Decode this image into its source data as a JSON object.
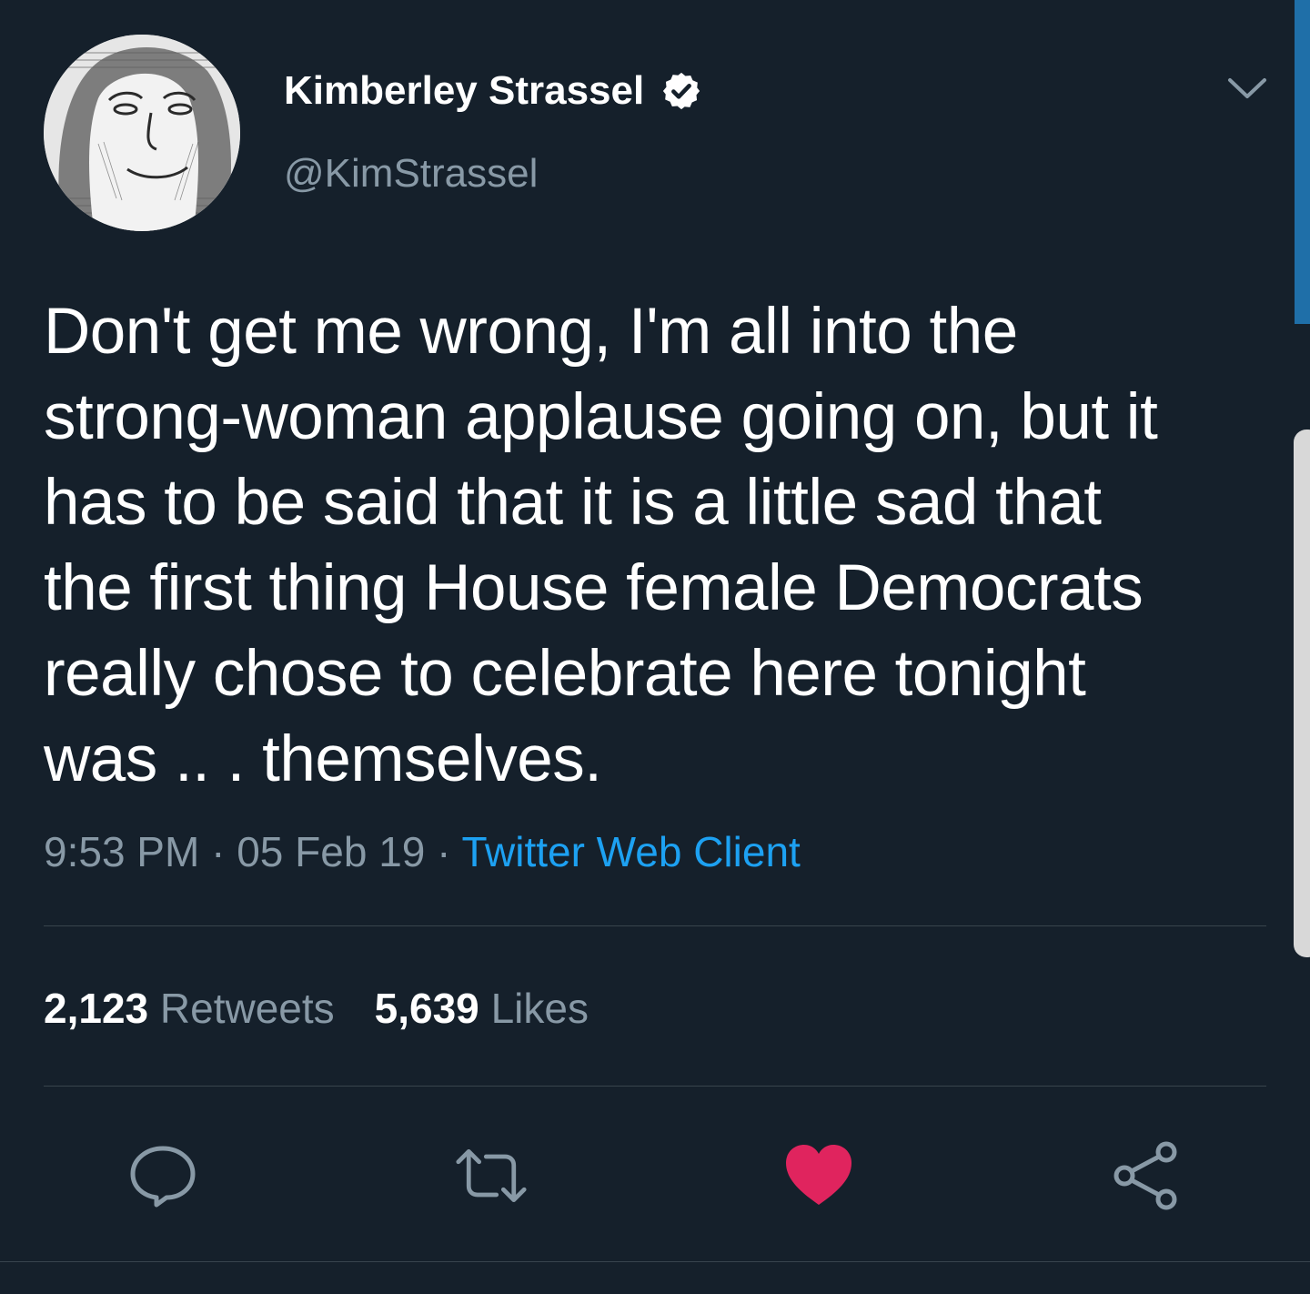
{
  "user": {
    "display_name": "Kimberley Strassel",
    "handle": "@KimStrassel",
    "verified": true
  },
  "tweet": {
    "text": "Don't get me wrong, I'm all into the\nstrong-woman applause going on, but it\nhas to be said that it is a little sad that\nthe first thing House female Democrats\nreally chose to celebrate here tonight\nwas .. . themselves.",
    "time": "9:53 PM",
    "separator": " · ",
    "date": "05 Feb 19",
    "source": "Twitter Web Client"
  },
  "stats": {
    "retweets_count": "2,123",
    "retweets_label": "Retweets",
    "likes_count": "5,639",
    "likes_label": "Likes"
  },
  "actions": {
    "reply_icon": "reply-icon",
    "retweet_icon": "retweet-icon",
    "like_icon": "heart-icon",
    "share_icon": "share-icon",
    "liked": true
  },
  "colors": {
    "background": "#15202b",
    "primary_text": "#ffffff",
    "secondary_text": "#8899a6",
    "accent": "#1da1f2",
    "like": "#e0245e",
    "divider": "#38444d"
  }
}
